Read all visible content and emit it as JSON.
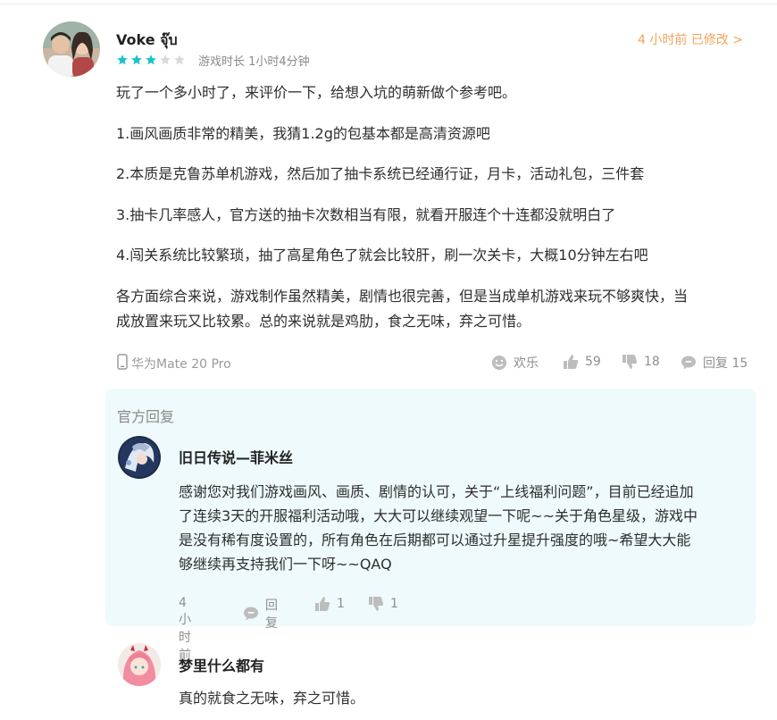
{
  "review": {
    "username": "Voke จุ๊บ",
    "rating": 3,
    "rating_max": 5,
    "playtime": "游戏时长 1小时4分钟",
    "timestamp": "4 小时前 已修改 >",
    "paragraphs": [
      "玩了一个多小时了，来评价一下，给想入坑的萌新做个参考吧。",
      "1.画风画质非常的精美，我猜1.2g的包基本都是高清资源吧",
      "2.本质是克鲁苏单机游戏，然后加了抽卡系统已经通行证，月卡，活动礼包，三件套",
      "3.抽卡几率感人，官方送的抽卡次数相当有限，就看开服连个十连都没就明白了",
      "4.闯关系统比较繁琐，抽了高星角色了就会比较肝，刷一次关卡，大概10分钟左右吧",
      "各方面综合来说，游戏制作虽然精美，剧情也很完善，但是当成单机游戏来玩不够爽快，当",
      "成放置来玩又比较累。总的来说就是鸡肋，食之无味，弃之可惜。"
    ],
    "device": "华为Mate 20 Pro",
    "mood_label": "欢乐",
    "likes": "59",
    "dislikes": "18",
    "reply_label": "回复 15"
  },
  "official_reply": {
    "label": "官方回复",
    "author": "旧日传说—菲米丝",
    "lines": [
      "感谢您对我们游戏画风、画质、剧情的认可，关于“上线福利问题”，目前已经追加",
      "了连续3天的开服福利活动哦，大大可以继续观望一下呢~~关于角色星级，游戏中",
      "是没有稀有度设置的，所有角色在后期都可以通过升星提升强度的哦~希望大大能",
      "够继续再支持我们一下呀~~QAQ"
    ],
    "time": "4 小时前",
    "reply_label": "回复",
    "likes": "1",
    "dislikes": "1"
  },
  "sub_reply": {
    "author": "梦里什么都有",
    "text": "真的就食之无味，弃之可惜。"
  },
  "colors": {
    "star_on": "#15c5ce",
    "star_off": "#d9d9d9",
    "timestamp": "#f4a259",
    "official_bg": "#eefafb"
  }
}
